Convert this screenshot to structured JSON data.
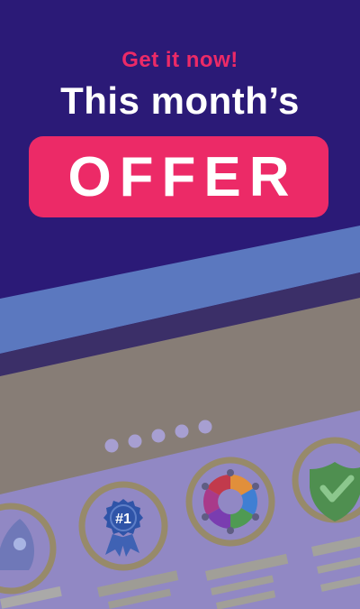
{
  "promo": {
    "kicker": "Get it now!",
    "headline": "This month’s",
    "cta_word": "OFFER"
  },
  "carousel": {
    "page_count": 5,
    "badges": [
      {
        "icon": "rocket-icon",
        "label": ""
      },
      {
        "icon": "ribbon-badge-icon",
        "label": "#1"
      },
      {
        "icon": "team-circle-icon",
        "label": ""
      },
      {
        "icon": "shield-check-icon",
        "label": ""
      }
    ]
  },
  "colors": {
    "background": "#2b1a77",
    "accent": "#ec2a67",
    "stripe": "#5b78bf",
    "panel": "#877d76",
    "cards": "#9188c4",
    "circle_ring": "#978a6a"
  }
}
